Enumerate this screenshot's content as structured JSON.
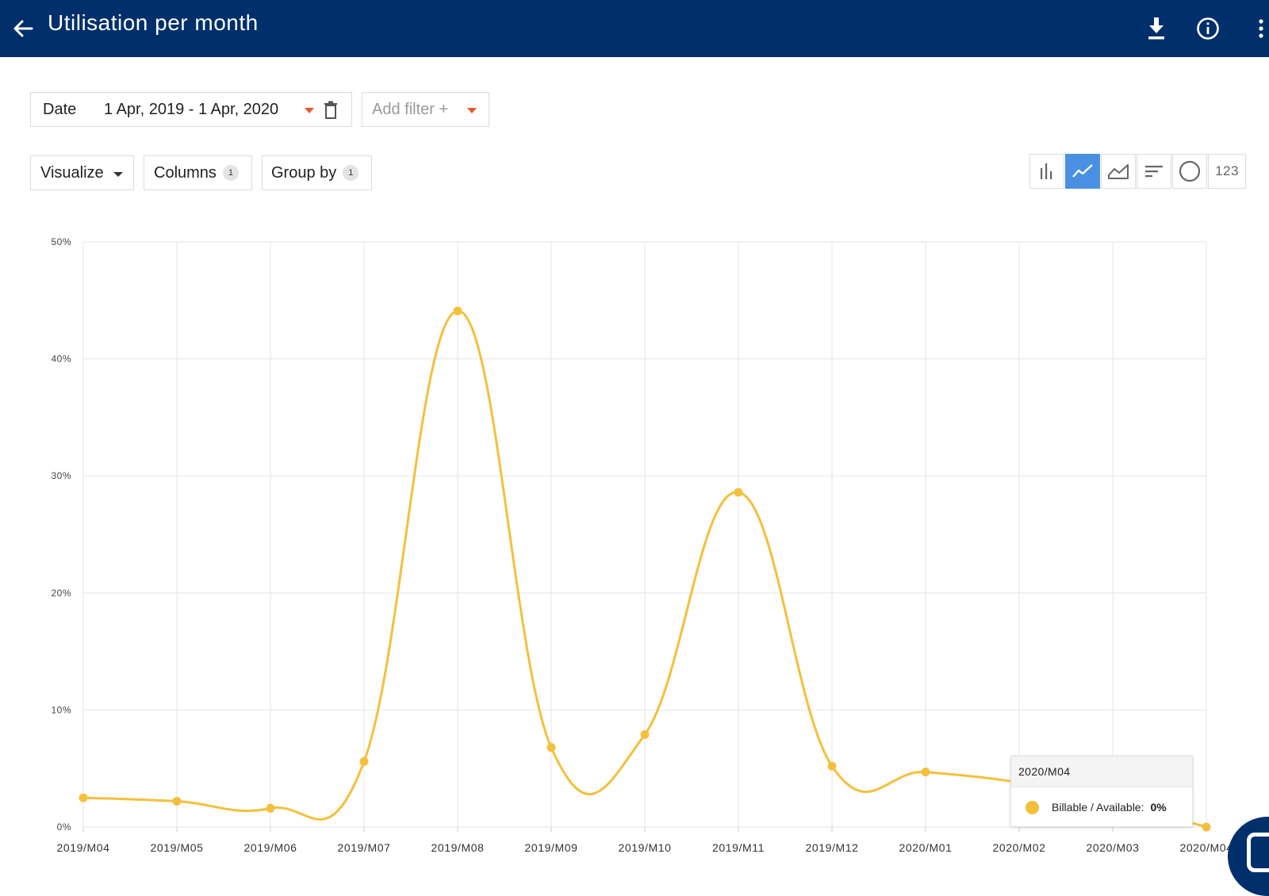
{
  "header": {
    "title": "Utilisation per month"
  },
  "filters": {
    "date_label": "Date",
    "date_value": "1 Apr, 2019 - 1 Apr, 2020",
    "add_filter_label": "Add filter +"
  },
  "controls": {
    "visualize_label": "Visualize",
    "columns_label": "Columns",
    "columns_count": "1",
    "groupby_label": "Group by",
    "groupby_count": "1",
    "number_view_label": "123"
  },
  "colors": {
    "header": "#002f6c",
    "series": "#f4c03c",
    "active_view": "#4a90e2",
    "caret": "#e35a2a"
  },
  "icons": [
    "back-arrow-icon",
    "download-icon",
    "info-icon",
    "more-vert-icon",
    "trash-icon",
    "bar-chart-icon",
    "line-chart-icon",
    "area-chart-icon",
    "horizontal-bar-icon",
    "pie-chart-icon"
  ],
  "chart_data": {
    "type": "line",
    "x": [
      "2019/M04",
      "2019/M05",
      "2019/M06",
      "2019/M07",
      "2019/M08",
      "2019/M09",
      "2019/M10",
      "2019/M11",
      "2019/M12",
      "2020/M01",
      "2020/M02",
      "2020/M03",
      "2020/M04"
    ],
    "series": [
      {
        "name": "Billable / Available",
        "values": [
          2.5,
          2.2,
          1.6,
          5.6,
          44.1,
          6.8,
          7.9,
          28.6,
          5.2,
          4.7,
          3.8,
          2.2,
          0
        ]
      }
    ],
    "ylim": [
      0,
      50
    ],
    "yticks": [
      "0%",
      "10%",
      "20%",
      "30%",
      "40%",
      "50%"
    ],
    "grid": true
  },
  "tooltip": {
    "title": "2020/M04",
    "label": "Billable / Available:",
    "value": "0%"
  }
}
